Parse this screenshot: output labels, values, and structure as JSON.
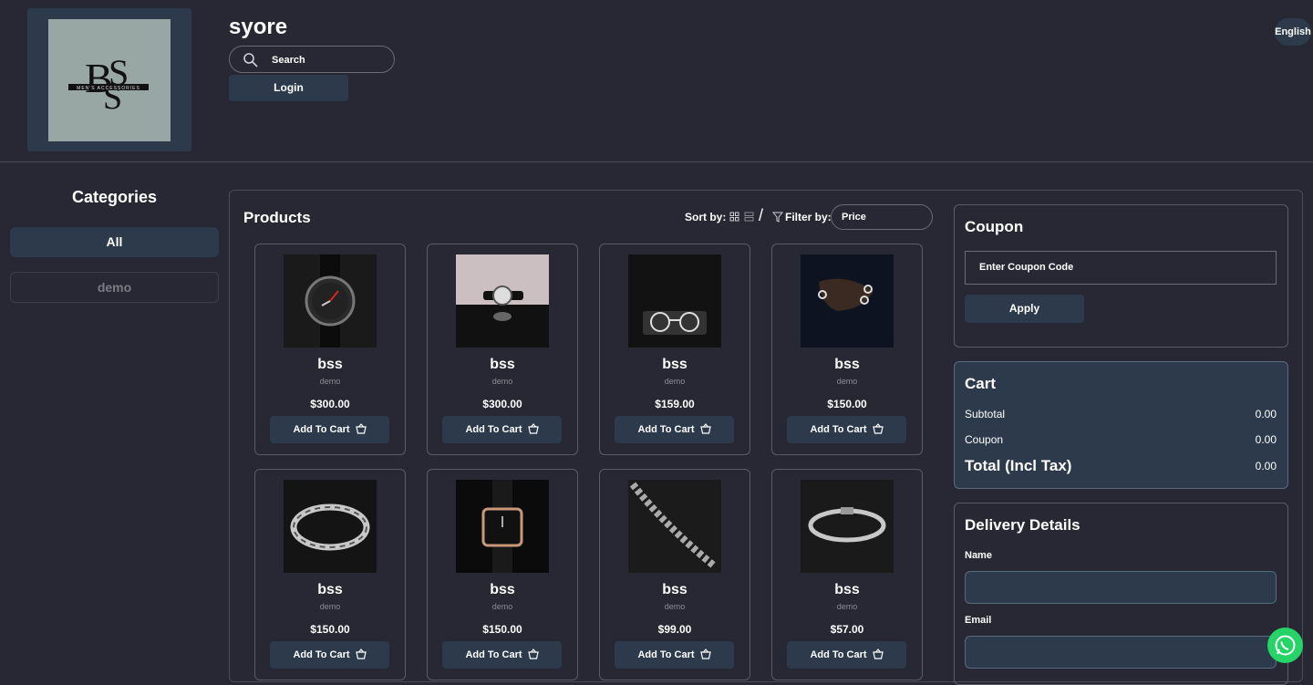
{
  "header": {
    "store_name": "syore",
    "search_label": "Search",
    "login_label": "Login",
    "language_label": "English",
    "logo_text": "MEN'S ACCESSORIES"
  },
  "categories": {
    "title": "Categories",
    "items": [
      {
        "label": "All",
        "active": true
      },
      {
        "label": "demo",
        "active": false
      }
    ]
  },
  "products_section": {
    "title": "Products",
    "sort_label": "Sort by:",
    "filter_label": "Filter by:",
    "filter_value": "Price",
    "items": [
      {
        "name": "bss",
        "category": "demo",
        "price": "$300.00",
        "button": "Add To Cart",
        "image": "watch-dark"
      },
      {
        "name": "bss",
        "category": "demo",
        "price": "$300.00",
        "button": "Add To Cart",
        "image": "watch-light"
      },
      {
        "name": "bss",
        "category": "demo",
        "price": "$159.00",
        "button": "Add To Cart",
        "image": "glasses"
      },
      {
        "name": "bss",
        "category": "demo",
        "price": "$150.00",
        "button": "Add To Cart",
        "image": "rings"
      },
      {
        "name": "bss",
        "category": "demo",
        "price": "$150.00",
        "button": "Add To Cart",
        "image": "bracelet"
      },
      {
        "name": "bss",
        "category": "demo",
        "price": "$150.00",
        "button": "Add To Cart",
        "image": "watch-gold"
      },
      {
        "name": "bss",
        "category": "demo",
        "price": "$99.00",
        "button": "Add To Cart",
        "image": "chain"
      },
      {
        "name": "bss",
        "category": "demo",
        "price": "$57.00",
        "button": "Add To Cart",
        "image": "bracelet-thin"
      }
    ]
  },
  "coupon": {
    "title": "Coupon",
    "placeholder": "Enter Coupon Code",
    "apply_label": "Apply"
  },
  "cart": {
    "title": "Cart",
    "subtotal_label": "Subtotal",
    "subtotal_value": "0.00",
    "coupon_label": "Coupon",
    "coupon_value": "0.00",
    "total_label": "Total (Incl Tax)",
    "total_value": "0.00"
  },
  "delivery": {
    "title": "Delivery Details",
    "name_label": "Name",
    "email_label": "Email"
  },
  "colors": {
    "background": "#272833",
    "accent": "#2c3a4c",
    "whatsapp": "#25d366"
  }
}
